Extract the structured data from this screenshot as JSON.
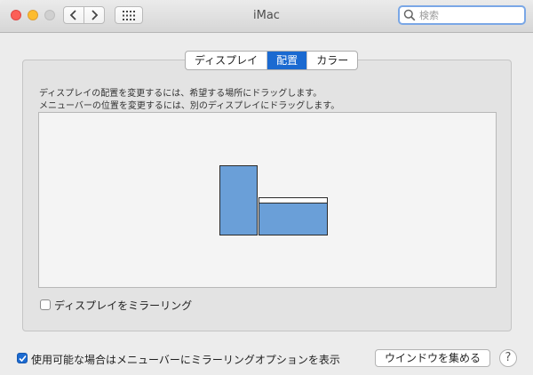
{
  "window": {
    "title": "iMac",
    "search_placeholder": "検索"
  },
  "tabs": [
    {
      "label": "ディスプレイ",
      "active": false
    },
    {
      "label": "配置",
      "active": true
    },
    {
      "label": "カラー",
      "active": false
    }
  ],
  "arrangement": {
    "instruction_1": "ディスプレイの配置を変更するには、希望する場所にドラッグします。",
    "instruction_2": "メニューバーの位置を変更するには、別のディスプレイにドラッグします。",
    "mirror_label": "ディスプレイをミラーリング",
    "mirror_checked": false
  },
  "footer": {
    "show_mirroring_label": "使用可能な場合はメニューバーにミラーリングオプションを表示",
    "show_mirroring_checked": true,
    "gather_windows_label": "ウインドウを集める",
    "help_label": "?"
  },
  "colors": {
    "accent": "#1b6ad1",
    "display_fill": "#6a9fd8"
  }
}
